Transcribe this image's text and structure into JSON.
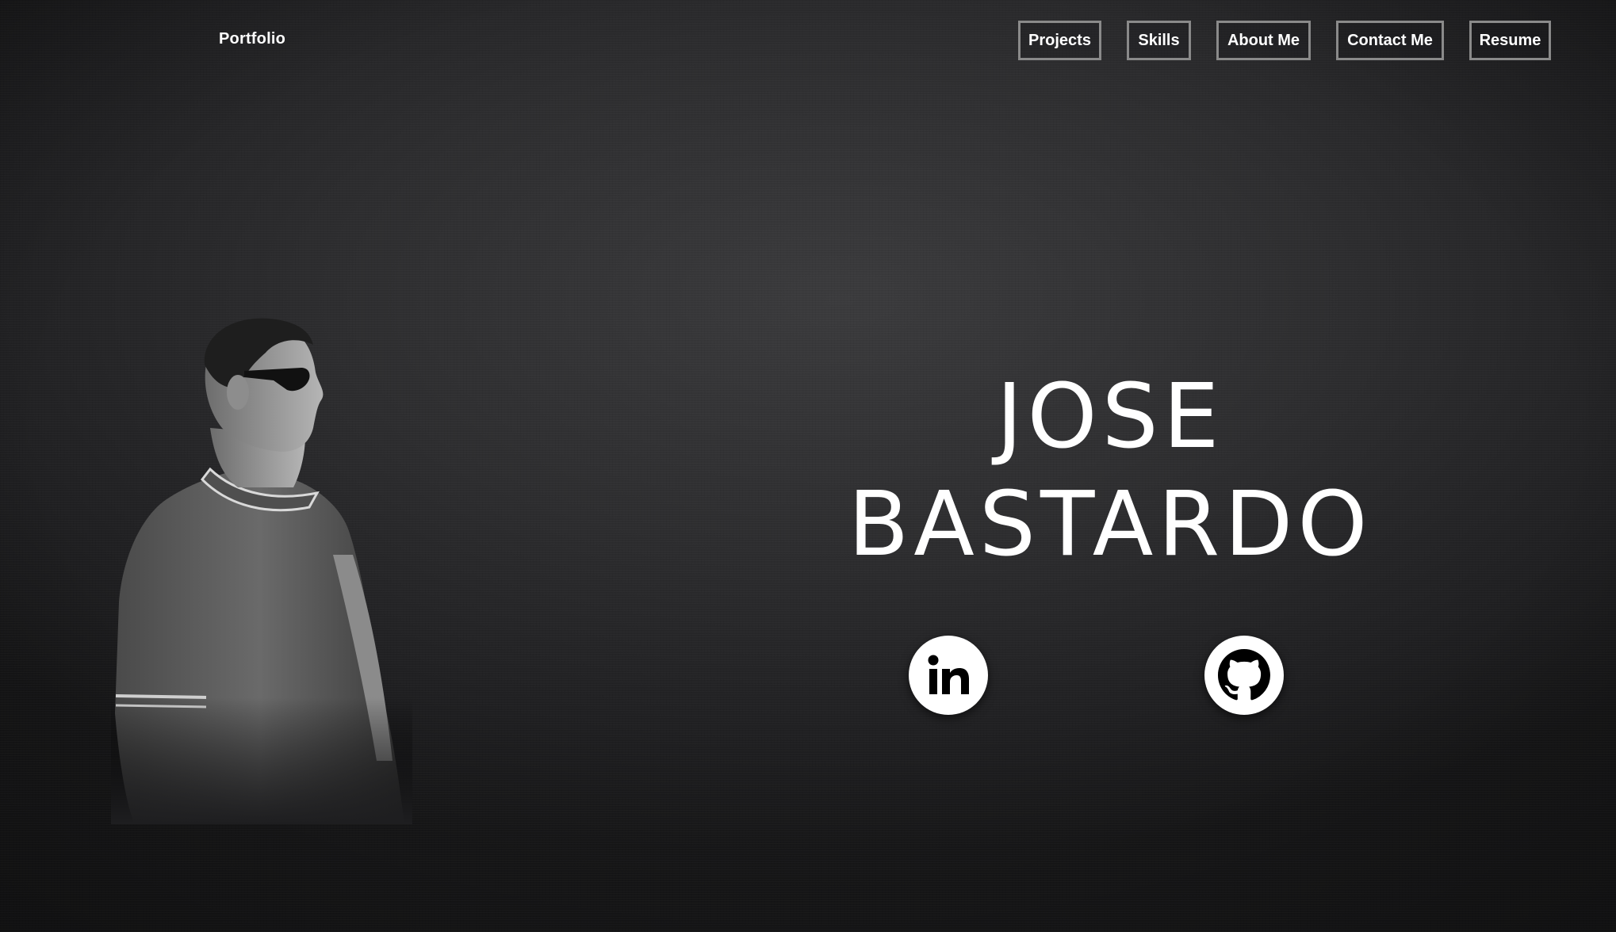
{
  "header": {
    "brand": "Portfolio",
    "nav": {
      "projects": "Projects",
      "skills": "Skills",
      "about": "About Me",
      "contact": "Contact Me",
      "resume": "Resume"
    }
  },
  "hero": {
    "first_name": "JOSE",
    "last_name": "BASTARDO",
    "social": [
      {
        "name": "linkedin-icon",
        "label": "in"
      },
      {
        "name": "github-icon"
      }
    ]
  },
  "colors": {
    "background": "#2d2d2f",
    "text": "#ffffff",
    "nav_border": "#8a8a8a",
    "icon_bg": "#ffffff",
    "icon_fg": "#000000"
  }
}
